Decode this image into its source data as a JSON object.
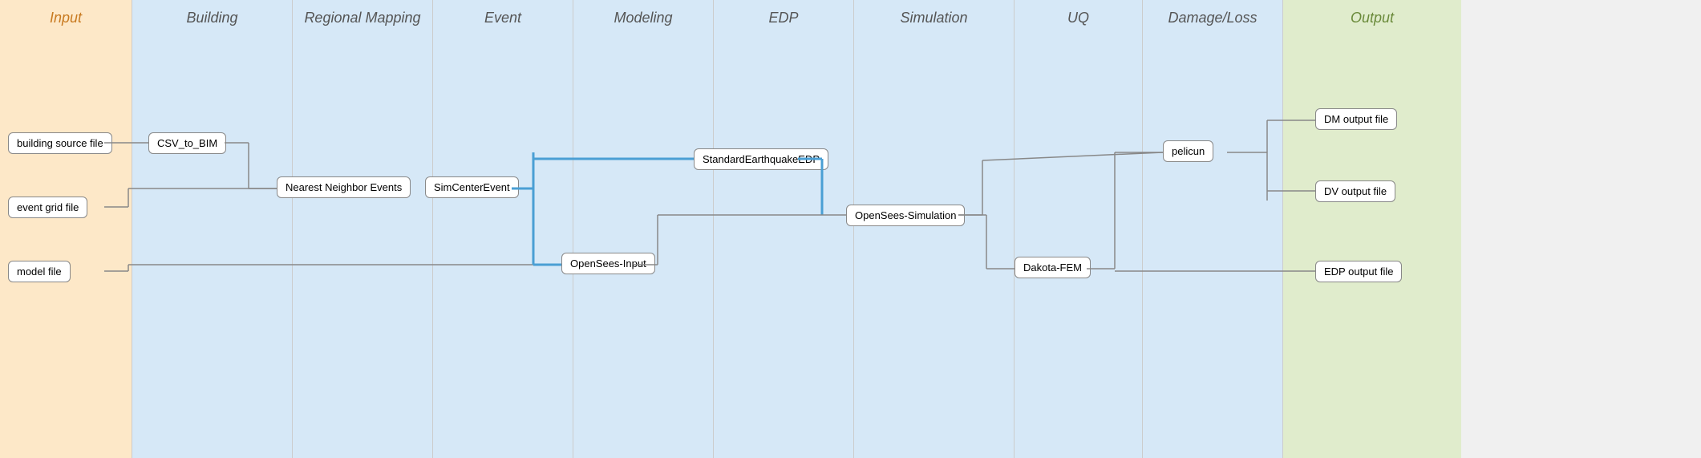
{
  "columns": [
    {
      "id": "input",
      "label": "Input",
      "class": "col-input"
    },
    {
      "id": "building",
      "label": "Building",
      "class": "col-building"
    },
    {
      "id": "regional",
      "label": "Regional Mapping",
      "class": "col-regional"
    },
    {
      "id": "event",
      "label": "Event",
      "class": "col-event"
    },
    {
      "id": "modeling",
      "label": "Modeling",
      "class": "col-modeling"
    },
    {
      "id": "edp",
      "label": "EDP",
      "class": "col-edp"
    },
    {
      "id": "simulation",
      "label": "Simulation",
      "class": "col-simulation"
    },
    {
      "id": "uq",
      "label": "UQ",
      "class": "col-uq"
    },
    {
      "id": "damage",
      "label": "Damage/Loss",
      "class": "col-damage"
    },
    {
      "id": "output",
      "label": "Output",
      "class": "col-output"
    }
  ],
  "nodes": {
    "building_source": "building source file",
    "event_grid": "event grid file",
    "model_file": "model file",
    "csv_to_bim": "CSV_to_BIM",
    "nearest_neighbor": "Nearest Neighbor Events",
    "simcenter_event": "SimCenterEvent",
    "opensees_input": "OpenSees-Input",
    "standard_edp": "StandardEarthquakeEDP",
    "opensees_sim": "OpenSees-Simulation",
    "pelicun": "pelicun",
    "dakota_fem": "Dakota-FEM",
    "dm_output": "DM output file",
    "dv_output": "DV output file",
    "edp_output": "EDP output file"
  }
}
